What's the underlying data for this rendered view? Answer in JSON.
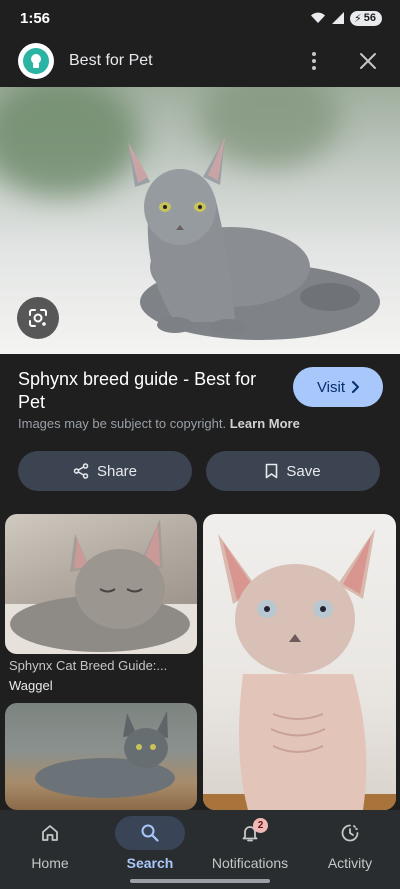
{
  "status_bar": {
    "time": "1:56",
    "battery": "56"
  },
  "header": {
    "site_name": "Best for Pet",
    "logo_icon": "pet-logo-icon"
  },
  "result": {
    "title": "Sphynx breed guide - Best for Pet",
    "visit_label": "Visit",
    "copyright_text": "Images may be subject to copyright.",
    "learn_more": "Learn More"
  },
  "actions": {
    "share_label": "Share",
    "save_label": "Save"
  },
  "related": [
    {
      "caption": "Sphynx Cat Breed Guide:...",
      "source": "Waggel"
    }
  ],
  "bottom_nav": [
    {
      "label": "Home",
      "icon": "home-icon"
    },
    {
      "label": "Search",
      "icon": "search-icon",
      "active": true
    },
    {
      "label": "Notifications",
      "icon": "bell-icon",
      "badge": "2"
    },
    {
      "label": "Activity",
      "icon": "activity-icon"
    }
  ],
  "colors": {
    "background": "#1f1f1f",
    "accent": "#a8c7fa",
    "button": "#3c4452"
  }
}
